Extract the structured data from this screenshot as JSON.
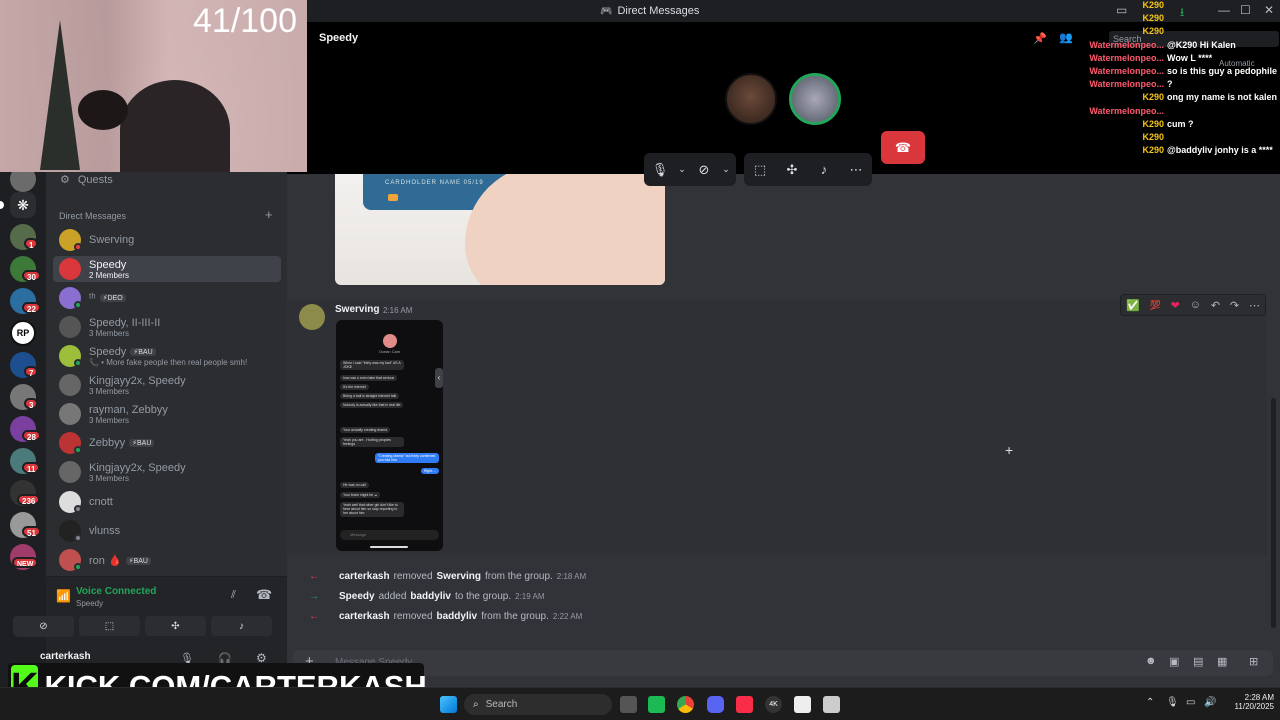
{
  "window": {
    "title": "Direct Messages"
  },
  "overlay": {
    "counter": "41/100",
    "kick_url": "KICK.COM/CARTERKASH",
    "kick_logo_letter": "K"
  },
  "stream_chat": [
    {
      "user": "K290",
      "text": "",
      "color": "#f5c518"
    },
    {
      "user": "K290",
      "text": "",
      "color": "#f5c518"
    },
    {
      "user": "K290",
      "text": "",
      "color": "#f5c518"
    },
    {
      "user": "Watermelonpeo...",
      "text": "@K290 Hi Kalen",
      "color": "#ff5a6e"
    },
    {
      "user": "Watermelonpeo...",
      "text": "Wow L ****",
      "color": "#ff5a6e"
    },
    {
      "user": "Watermelonpeo...",
      "text": "so is this guy a pedophile",
      "color": "#ff5a6e"
    },
    {
      "user": "Watermelonpeo...",
      "text": "?",
      "color": "#ff5a6e"
    },
    {
      "user": "K290",
      "text": "ong my name is not kalen",
      "color": "#f5c518"
    },
    {
      "user": "Watermelonpeo...",
      "text": "",
      "color": "#ff5a6e"
    },
    {
      "user": "K290",
      "text": "cum ?",
      "color": "#f5c518"
    },
    {
      "user": "K290",
      "text": "",
      "color": "#f5c518"
    },
    {
      "user": "K290",
      "text": "@baddyliv jonhy is a ****",
      "color": "#f5c518"
    }
  ],
  "call": {
    "header_name": "Speedy",
    "search_placeholder": "Search",
    "automatic_label": "Automatic"
  },
  "sidebar": {
    "quests_label": "Quests",
    "dm_header": "Direct Messages",
    "dms": [
      {
        "name": "Swerving",
        "sub": "",
        "tag": "",
        "color": "#c9a227",
        "status": "#f23f43"
      },
      {
        "name": "Speedy",
        "sub": "2 Members",
        "tag": "",
        "color": "#da373c",
        "status": "",
        "active": true
      },
      {
        "name": "ᵗʰ",
        "sub": "",
        "tag": "⚡DEO",
        "color": "#8a6fd1",
        "status": "#23a55a"
      },
      {
        "name": "Speedy, II-III-II",
        "sub": "3 Members",
        "tag": "",
        "color": "#555",
        "status": ""
      },
      {
        "name": "Speedy",
        "sub": "📞 • More fake people then real people smh!",
        "tag": "⚡BAU",
        "color": "#9bbf3a",
        "status": "#23a55a"
      },
      {
        "name": "Kingjayy2x, Speedy",
        "sub": "3 Members",
        "tag": "",
        "color": "#666",
        "status": ""
      },
      {
        "name": "rayman, Zebbyy",
        "sub": "3 Members",
        "tag": "",
        "color": "#777",
        "status": ""
      },
      {
        "name": "Zebbyy",
        "sub": "",
        "tag": "⚡BAU",
        "color": "#b33",
        "status": "#23a55a"
      },
      {
        "name": "Kingjayy2x, Speedy",
        "sub": "3 Members",
        "tag": "",
        "color": "#666",
        "status": ""
      },
      {
        "name": "cnott",
        "sub": "",
        "tag": "",
        "color": "#ddd",
        "status": "#80848e"
      },
      {
        "name": "vlunss",
        "sub": "",
        "tag": "",
        "color": "#222",
        "status": "#80848e"
      },
      {
        "name": "ron 🩸",
        "sub": "",
        "tag": "⚡BAU",
        "color": "#c05050",
        "status": "#23a55a"
      }
    ],
    "voice": {
      "status": "Voice Connected",
      "channel": "Speedy"
    },
    "user": {
      "name": "carterkash"
    }
  },
  "rail_badges": [
    "1",
    "30",
    "22",
    "",
    "7",
    "3",
    "28",
    "11",
    "236",
    "51",
    "NEW"
  ],
  "messages": {
    "author": "Swerving",
    "time": "2:16 AM",
    "card_text": "CARDHOLDER NAME   05/19",
    "phone_bubbles": [
      "When I said \"thirty was my bad\" AS A JOKE",
      "how can u even take that serious",
      "It's the internet",
      "Being a ball is straight internet talk",
      "Nobody is actually like that in real life",
      "Your actually creating drama",
      "Yeah you are . Hurting peoples feelings",
      "\"Creating drama\" but thirty confirmed you told him",
      "Right....",
      "He was on call",
      "Your brain might be ☕",
      "Yeah well that other girl don't like to hear about him so stop reporting to her about him"
    ],
    "phone_contact": "Ocean Cam",
    "phone_placeholder": "Message",
    "system": [
      {
        "actor": "carterkash",
        "verb": "removed",
        "target": "Swerving",
        "tail": "from the group.",
        "time": "2:18 AM",
        "kind": "remove"
      },
      {
        "actor": "Speedy",
        "verb": "added",
        "target": "baddyliv",
        "tail": "to the group.",
        "time": "2:19 AM",
        "kind": "add"
      },
      {
        "actor": "carterkash",
        "verb": "removed",
        "target": "baddyliv",
        "tail": "from the group.",
        "time": "2:22 AM",
        "kind": "remove"
      }
    ],
    "composer_placeholder": "Message Speedy",
    "reactions": [
      "✅",
      "💯",
      "❤"
    ]
  },
  "taskbar": {
    "search_placeholder": "Search",
    "time": "2:28 AM",
    "date": "11/20/2025"
  },
  "colors": {
    "accent": "#5865f2",
    "danger": "#da373c",
    "online": "#23a55a",
    "kick": "#53fc18"
  }
}
